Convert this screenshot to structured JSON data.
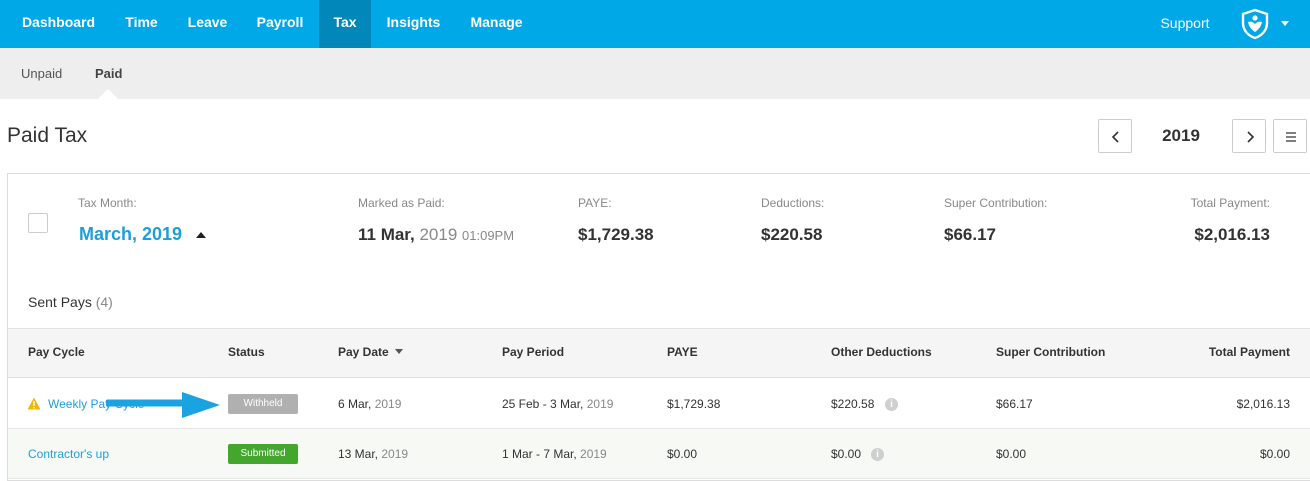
{
  "topnav": {
    "items": [
      "Dashboard",
      "Time",
      "Leave",
      "Payroll",
      "Tax",
      "Insights",
      "Manage"
    ],
    "active": "Tax",
    "support": "Support",
    "accent": "#00a8e8",
    "active_bg": "#0187b9"
  },
  "subnav": {
    "items": [
      "Unpaid",
      "Paid"
    ],
    "active": "Paid"
  },
  "page": {
    "title": "Paid Tax",
    "year": "2019"
  },
  "summary": {
    "tax_month_label": "Tax Month:",
    "tax_month": "March, 2019",
    "marked_label": "Marked as Paid:",
    "marked_date": "11 Mar,",
    "marked_year": "2019",
    "marked_time": "01:09PM",
    "paye_label": "PAYE:",
    "paye": "$1,729.38",
    "deductions_label": "Deductions:",
    "deductions": "$220.58",
    "super_label": "Super Contribution:",
    "super": "$66.17",
    "total_label": "Total Payment:",
    "total": "$2,016.13"
  },
  "sent_pays": {
    "label": "Sent Pays",
    "count": "(4)"
  },
  "table": {
    "headers": {
      "pay_cycle": "Pay Cycle",
      "status": "Status",
      "pay_date": "Pay Date",
      "pay_period": "Pay Period",
      "paye": "PAYE",
      "other_deductions": "Other Deductions",
      "super": "Super Contribution",
      "total": "Total Payment"
    },
    "rows": [
      {
        "pay_cycle": "Weekly Pay Cycle",
        "status": "Withheld",
        "pay_date": "6 Mar,",
        "pay_date_year": "2019",
        "pay_period": "25 Feb - 3 Mar,",
        "pay_period_year": "2019",
        "paye": "$1,729.38",
        "other_deductions": "$220.58",
        "super": "$66.17",
        "total": "$2,016.13"
      },
      {
        "pay_cycle": "Contractor's up",
        "status": "Submitted",
        "pay_date": "13 Mar,",
        "pay_date_year": "2019",
        "pay_period": "1 Mar - 7 Mar,",
        "pay_period_year": "2019",
        "paye": "$0.00",
        "other_deductions": "$0.00",
        "super": "$0.00",
        "total": "$0.00"
      }
    ]
  },
  "colors": {
    "link": "#1e9fda",
    "withheld": "#b0b0b0",
    "submitted": "#43a72e",
    "annotation_arrow": "#1aa3e0"
  },
  "icons": {
    "logo": "shield-heart-logo",
    "warning": "warning-icon",
    "info": "info-icon",
    "prev": "chevron-left-icon",
    "next": "chevron-right-icon",
    "menu": "hamburger-icon"
  }
}
